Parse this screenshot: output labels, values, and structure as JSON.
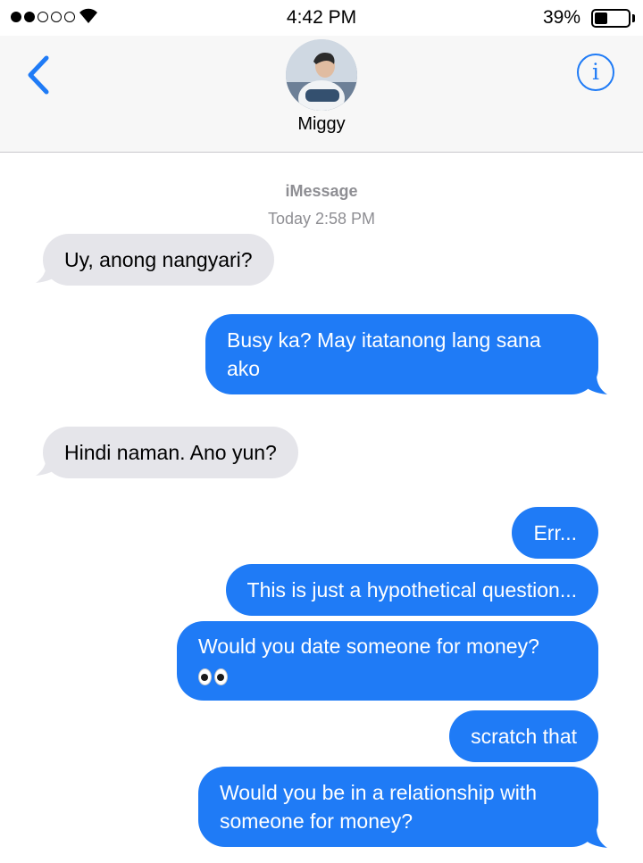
{
  "status_bar": {
    "time": "4:42 PM",
    "battery_percent": "39%",
    "battery_level": 0.39,
    "signal_bars_filled": 2,
    "signal_bars_total": 5
  },
  "header": {
    "contact_name": "Miggy",
    "back_icon": "chevron-left-icon",
    "info_icon": "info-icon",
    "info_glyph": "i"
  },
  "conversation": {
    "service": "iMessage",
    "timestamp": "Today 2:58 PM",
    "messages": [
      {
        "direction": "incoming",
        "text": "Uy, anong nangyari?"
      },
      {
        "direction": "outgoing",
        "text": "Busy ka? May itatanong lang sana ako"
      },
      {
        "direction": "incoming",
        "text": "Hindi naman. Ano yun?"
      },
      {
        "direction": "outgoing",
        "text": "Err..."
      },
      {
        "direction": "outgoing",
        "text": "This is just a hypothetical question..."
      },
      {
        "direction": "outgoing",
        "text": "Would you date someone for money?",
        "emoji": "eyes-emoji"
      },
      {
        "direction": "outgoing",
        "text": "scratch that"
      },
      {
        "direction": "outgoing",
        "text": "Would you be in a relationship with someone for money?"
      }
    ]
  },
  "colors": {
    "accent": "#1f7bf6",
    "incoming_bubble": "#e5e5ea",
    "outgoing_bubble": "#1f7bf6",
    "meta_text": "#8e8e93"
  }
}
